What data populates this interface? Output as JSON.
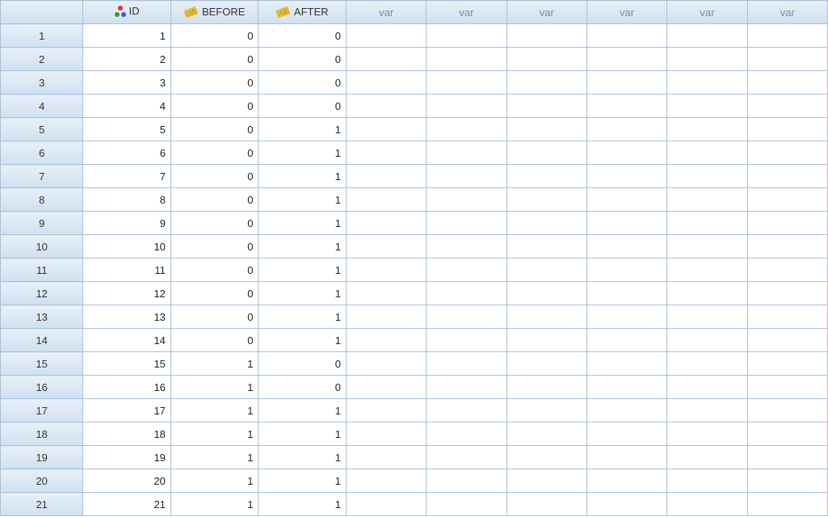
{
  "columns": [
    {
      "name": "ID",
      "icon": "nominal"
    },
    {
      "name": "BEFORE",
      "icon": "scale"
    },
    {
      "name": "AFTER",
      "icon": "scale"
    }
  ],
  "empty_var_label": "var",
  "empty_var_count": 6,
  "rows": [
    {
      "num": 1,
      "ID": 1,
      "BEFORE": 0,
      "AFTER": 0
    },
    {
      "num": 2,
      "ID": 2,
      "BEFORE": 0,
      "AFTER": 0
    },
    {
      "num": 3,
      "ID": 3,
      "BEFORE": 0,
      "AFTER": 0
    },
    {
      "num": 4,
      "ID": 4,
      "BEFORE": 0,
      "AFTER": 0
    },
    {
      "num": 5,
      "ID": 5,
      "BEFORE": 0,
      "AFTER": 1
    },
    {
      "num": 6,
      "ID": 6,
      "BEFORE": 0,
      "AFTER": 1
    },
    {
      "num": 7,
      "ID": 7,
      "BEFORE": 0,
      "AFTER": 1
    },
    {
      "num": 8,
      "ID": 8,
      "BEFORE": 0,
      "AFTER": 1
    },
    {
      "num": 9,
      "ID": 9,
      "BEFORE": 0,
      "AFTER": 1
    },
    {
      "num": 10,
      "ID": 10,
      "BEFORE": 0,
      "AFTER": 1
    },
    {
      "num": 11,
      "ID": 11,
      "BEFORE": 0,
      "AFTER": 1
    },
    {
      "num": 12,
      "ID": 12,
      "BEFORE": 0,
      "AFTER": 1
    },
    {
      "num": 13,
      "ID": 13,
      "BEFORE": 0,
      "AFTER": 1
    },
    {
      "num": 14,
      "ID": 14,
      "BEFORE": 0,
      "AFTER": 1
    },
    {
      "num": 15,
      "ID": 15,
      "BEFORE": 1,
      "AFTER": 0
    },
    {
      "num": 16,
      "ID": 16,
      "BEFORE": 1,
      "AFTER": 0
    },
    {
      "num": 17,
      "ID": 17,
      "BEFORE": 1,
      "AFTER": 1
    },
    {
      "num": 18,
      "ID": 18,
      "BEFORE": 1,
      "AFTER": 1
    },
    {
      "num": 19,
      "ID": 19,
      "BEFORE": 1,
      "AFTER": 1
    },
    {
      "num": 20,
      "ID": 20,
      "BEFORE": 1,
      "AFTER": 1
    },
    {
      "num": 21,
      "ID": 21,
      "BEFORE": 1,
      "AFTER": 1
    }
  ]
}
